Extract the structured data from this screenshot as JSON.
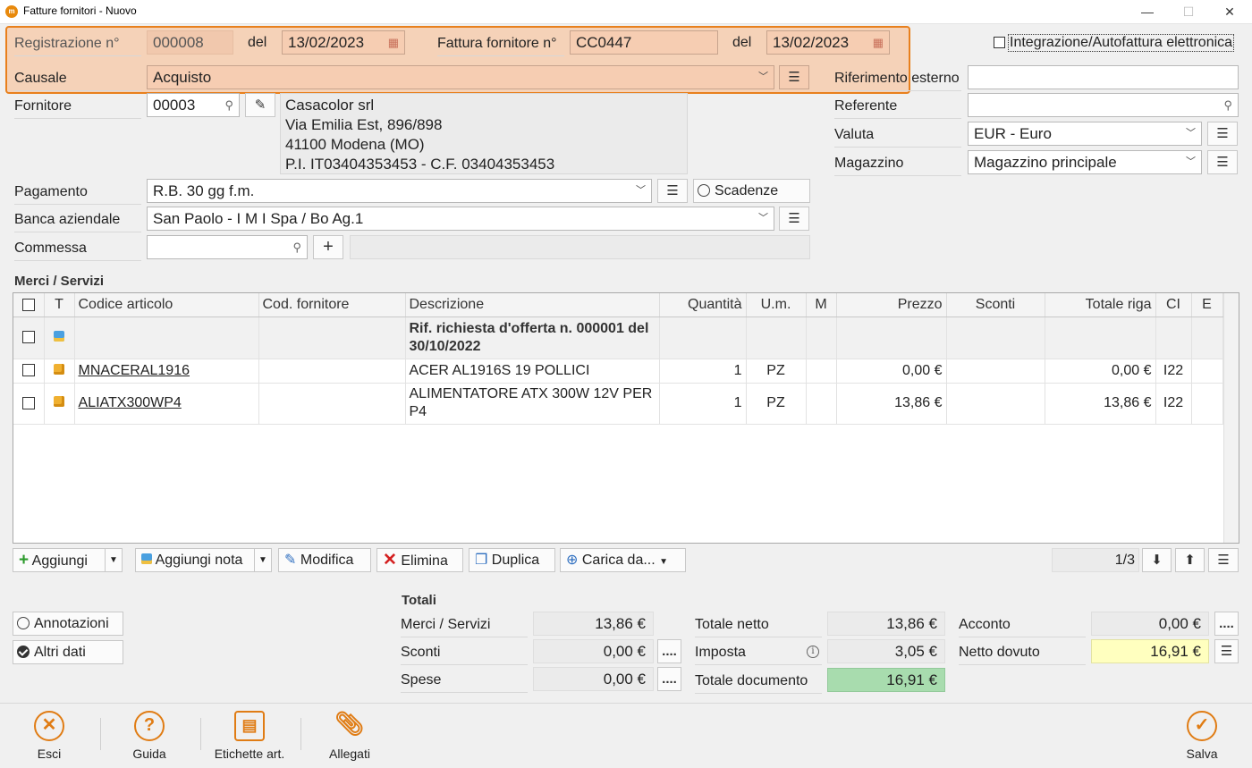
{
  "window": {
    "title": "Fatture fornitori - Nuovo",
    "minimize": "—",
    "maximize": "☐",
    "close": "✕"
  },
  "header": {
    "reg_label": "Registrazione n°",
    "reg_value": "000008",
    "del_label": "del",
    "reg_date": "13/02/2023",
    "fattura_label": "Fattura fornitore n°",
    "fattura_value": "CC0447",
    "fattura_date": "13/02/2023",
    "causale_label": "Causale",
    "causale_value": "Acquisto",
    "integrazione_label": "Integrazione/Autofattura elettronica"
  },
  "right_fields": {
    "rif_label": "Riferimento esterno",
    "rif_value": "",
    "referente_label": "Referente",
    "referente_value": "",
    "valuta_label": "Valuta",
    "valuta_value": "EUR - Euro",
    "magazzino_label": "Magazzino",
    "magazzino_value": "Magazzino principale"
  },
  "supplier": {
    "label": "Fornitore",
    "code": "00003",
    "lines": [
      "Casacolor srl",
      "Via Emilia Est, 896/898",
      "41100 Modena (MO)",
      "P.I. IT03404353453 - C.F. 03404353453"
    ]
  },
  "payment": {
    "pagamento_label": "Pagamento",
    "pagamento_value": "R.B. 30 gg f.m.",
    "scadenze_label": "Scadenze",
    "banca_label": "Banca aziendale",
    "banca_value": "San Paolo - I M I Spa / Bo Ag.1",
    "commessa_label": "Commessa",
    "commessa_value": ""
  },
  "grid": {
    "section_title": "Merci / Servizi",
    "columns": [
      "T",
      "Codice articolo",
      "Cod. fornitore",
      "Descrizione",
      "Quantità",
      "U.m.",
      "M",
      "Prezzo",
      "Sconti",
      "Totale riga",
      "CI",
      "E"
    ],
    "note_row": {
      "description": "Rif. richiesta d'offerta n. 000001 del 30/10/2022"
    },
    "rows": [
      {
        "code": "MNACERAL1916",
        "supplier_code": "",
        "description": "ACER AL1916S 19 POLLICI",
        "qty": "1",
        "um": "PZ",
        "m": "",
        "price": "0,00 €",
        "discount": "",
        "total": "0,00 €",
        "ci": "I22",
        "e": ""
      },
      {
        "code": "ALIATX300WP4",
        "supplier_code": "",
        "description": "ALIMENTATORE ATX 300W 12V PER P4",
        "qty": "1",
        "um": "PZ",
        "m": "",
        "price": "13,86 €",
        "discount": "",
        "total": "13,86 €",
        "ci": "I22",
        "e": ""
      }
    ]
  },
  "toolbar": {
    "aggiungi": "Aggiungi",
    "aggiungi_nota": "Aggiungi nota",
    "modifica": "Modifica",
    "elimina": "Elimina",
    "duplica": "Duplica",
    "carica": "Carica da...",
    "pager": "1/3"
  },
  "totals": {
    "title": "Totali",
    "merci_label": "Merci / Servizi",
    "merci_value": "13,86 €",
    "sconti_label": "Sconti",
    "sconti_value": "0,00 €",
    "spese_label": "Spese",
    "spese_value": "0,00 €",
    "netto_label": "Totale netto",
    "netto_value": "13,86 €",
    "imposta_label": "Imposta",
    "imposta_value": "3,05 €",
    "documento_label": "Totale documento",
    "documento_value": "16,91 €",
    "acconto_label": "Acconto",
    "acconto_value": "0,00 €",
    "dovuto_label": "Netto dovuto",
    "dovuto_value": "16,91 €",
    "more_btn": "...."
  },
  "side_toggles": {
    "annotazioni": "Annotazioni",
    "altri_dati": "Altri dati"
  },
  "bottom": {
    "esci": "Esci",
    "guida": "Guida",
    "etichette": "Etichette art.",
    "allegati": "Allegati",
    "salva": "Salva"
  },
  "colors": {
    "accent": "#e07c14",
    "highlight": "#f6cdb2",
    "total_green": "#a8dcae",
    "due_yellow": "#ffffbf"
  }
}
